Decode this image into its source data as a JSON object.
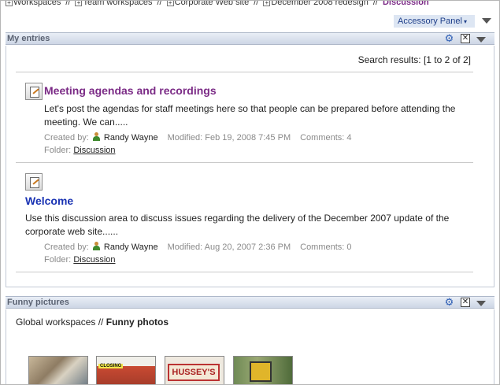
{
  "breadcrumb": {
    "items": [
      "Workspaces",
      "Team workspaces",
      "Corporate Web site",
      "December 2008 redesign"
    ],
    "separator": "//",
    "current": "Discussion",
    "expand_glyph": "+"
  },
  "accessory_panel": {
    "label": "Accessory Panel",
    "arrow": "▾"
  },
  "my_entries": {
    "title": "My entries",
    "results_text": "Search results: [1 to 2 of 2]",
    "entries": [
      {
        "title": "Meeting agendas and recordings",
        "excerpt": "Let's post the agendas for staff meetings here so that people can be prepared before attending the meeting. We can.....",
        "created_by_label": "Created by:",
        "author": "Randy Wayne",
        "modified": "Modified: Feb 19, 2008 7:45 PM",
        "comments": "Comments: 4",
        "folder_label": "Folder:",
        "folder": "Discussion"
      },
      {
        "title": "Welcome",
        "excerpt": "Use this discussion area to discuss issues regarding the delivery of the December 2007 update of the corporate web site......",
        "created_by_label": "Created by:",
        "author": "Randy Wayne",
        "modified": "Modified: Aug 20, 2007 2:36 PM",
        "comments": "Comments: 0",
        "folder_label": "Folder:",
        "folder": "Discussion"
      }
    ]
  },
  "funny_pictures": {
    "title": "Funny pictures",
    "path_prefix": "Global workspaces //",
    "path_current": "Funny photos",
    "thumb_texts": {
      "closing": "CLOSING",
      "sign": "HUSSEY'S"
    }
  },
  "icons": {
    "gear": "⚙",
    "close": "✕"
  },
  "colors": {
    "visited_title": "#7b2b86",
    "link_title": "#1a33b3",
    "accent": "#1f3f8a"
  }
}
